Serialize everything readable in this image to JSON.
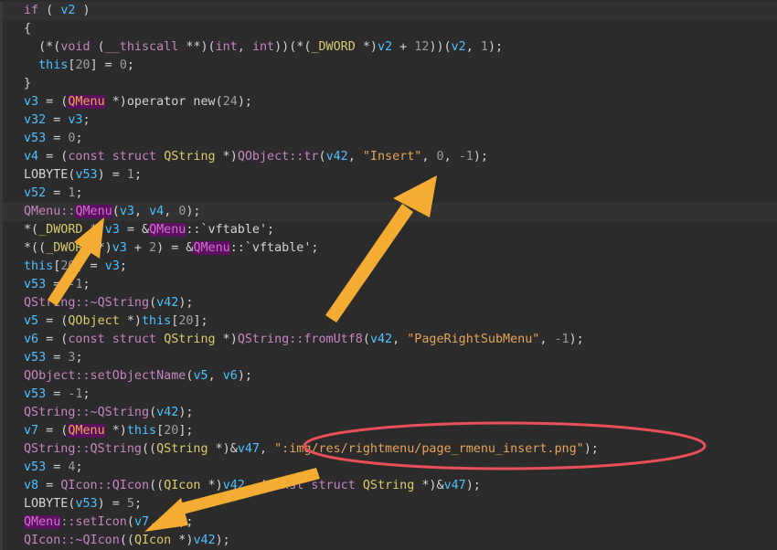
{
  "lines": [
    {
      "tokens": [
        [
          "kw",
          "if"
        ],
        [
          "plain",
          " ( "
        ],
        [
          "var",
          "v2"
        ],
        [
          "plain",
          " )"
        ]
      ]
    },
    {
      "tokens": [
        [
          "plain",
          "{"
        ]
      ]
    },
    {
      "tokens": [
        [
          "plain",
          "  (*("
        ],
        [
          "kw",
          "void"
        ],
        [
          "plain",
          " ("
        ],
        [
          "kw",
          "__thiscall"
        ],
        [
          "plain",
          " **)("
        ],
        [
          "kw",
          "int"
        ],
        [
          "plain",
          ", "
        ],
        [
          "kw",
          "int"
        ],
        [
          "plain",
          "))(*("
        ],
        [
          "type",
          "_DWORD"
        ],
        [
          "plain",
          " *)"
        ],
        [
          "var",
          "v2"
        ],
        [
          "plain",
          " + "
        ],
        [
          "num",
          "12"
        ],
        [
          "plain",
          "))("
        ],
        [
          "var",
          "v2"
        ],
        [
          "plain",
          ", "
        ],
        [
          "num",
          "1"
        ],
        [
          "plain",
          ");"
        ]
      ]
    },
    {
      "tokens": [
        [
          "plain",
          "  "
        ],
        [
          "var",
          "this"
        ],
        [
          "plain",
          "["
        ],
        [
          "num",
          "20"
        ],
        [
          "plain",
          "] = "
        ],
        [
          "num",
          "0"
        ],
        [
          "plain",
          ";"
        ]
      ]
    },
    {
      "tokens": [
        [
          "plain",
          "}"
        ]
      ]
    },
    {
      "tokens": [
        [
          "var",
          "v3"
        ],
        [
          "plain",
          " = ("
        ],
        [
          "cls",
          "QMenu"
        ],
        [
          "plain",
          " *)"
        ],
        [
          "plain",
          "operator new"
        ],
        [
          "plain",
          "("
        ],
        [
          "num",
          "24"
        ],
        [
          "plain",
          ");"
        ]
      ]
    },
    {
      "tokens": [
        [
          "var",
          "v32"
        ],
        [
          "plain",
          " = "
        ],
        [
          "var",
          "v3"
        ],
        [
          "plain",
          ";"
        ]
      ]
    },
    {
      "tokens": [
        [
          "var",
          "v53"
        ],
        [
          "plain",
          " = "
        ],
        [
          "num",
          "0"
        ],
        [
          "plain",
          ";"
        ]
      ]
    },
    {
      "tokens": [
        [
          "var",
          "v4"
        ],
        [
          "plain",
          " = ("
        ],
        [
          "kw",
          "const struct"
        ],
        [
          "plain",
          " "
        ],
        [
          "type",
          "QString"
        ],
        [
          "plain",
          " *)"
        ],
        [
          "fn",
          "QObject::tr"
        ],
        [
          "plain",
          "("
        ],
        [
          "var",
          "v42"
        ],
        [
          "plain",
          ", "
        ],
        [
          "str",
          "\"Insert\""
        ],
        [
          "plain",
          ", "
        ],
        [
          "num",
          "0"
        ],
        [
          "plain",
          ", "
        ],
        [
          "num",
          "-1"
        ],
        [
          "plain",
          ");"
        ]
      ]
    },
    {
      "tokens": [
        [
          "plain",
          "LOBYTE("
        ],
        [
          "var",
          "v53"
        ],
        [
          "plain",
          ") = "
        ],
        [
          "num",
          "1"
        ],
        [
          "plain",
          ";"
        ]
      ]
    },
    {
      "tokens": [
        [
          "var",
          "v52"
        ],
        [
          "plain",
          " = "
        ],
        [
          "num",
          "1"
        ],
        [
          "plain",
          ";"
        ]
      ]
    },
    {
      "tokens": [
        [
          "fn",
          "QMenu::"
        ],
        [
          "cls-p",
          "QMenu"
        ],
        [
          "plain",
          "("
        ],
        [
          "var",
          "v3"
        ],
        [
          "plain",
          ", "
        ],
        [
          "var",
          "v4"
        ],
        [
          "plain",
          ", "
        ],
        [
          "num",
          "0"
        ],
        [
          "plain",
          ");"
        ]
      ],
      "hl": true
    },
    {
      "tokens": [
        [
          "plain",
          "*("
        ],
        [
          "type",
          "_DWORD"
        ],
        [
          "plain",
          " *)"
        ],
        [
          "var",
          "v3"
        ],
        [
          "plain",
          " = &"
        ],
        [
          "cls-p",
          "QMenu"
        ],
        [
          "plain",
          "::`vftable';"
        ]
      ]
    },
    {
      "tokens": [
        [
          "plain",
          "*(("
        ],
        [
          "type",
          "_DWORD"
        ],
        [
          "plain",
          " *)"
        ],
        [
          "var",
          "v3"
        ],
        [
          "plain",
          " + "
        ],
        [
          "num",
          "2"
        ],
        [
          "plain",
          ") = &"
        ],
        [
          "cls-p",
          "QMenu"
        ],
        [
          "plain",
          "::`vftable';"
        ]
      ]
    },
    {
      "tokens": [
        [
          "var",
          "this"
        ],
        [
          "plain",
          "["
        ],
        [
          "num",
          "20"
        ],
        [
          "plain",
          "] = "
        ],
        [
          "var",
          "v3"
        ],
        [
          "plain",
          ";"
        ]
      ]
    },
    {
      "tokens": [
        [
          "var",
          "v53"
        ],
        [
          "plain",
          " = "
        ],
        [
          "num",
          "-1"
        ],
        [
          "plain",
          ";"
        ]
      ]
    },
    {
      "tokens": [
        [
          "fn",
          "QString::~QString"
        ],
        [
          "plain",
          "("
        ],
        [
          "var",
          "v42"
        ],
        [
          "plain",
          ");"
        ]
      ]
    },
    {
      "tokens": [
        [
          "var",
          "v5"
        ],
        [
          "plain",
          " = ("
        ],
        [
          "type",
          "QObject"
        ],
        [
          "plain",
          " *)"
        ],
        [
          "var",
          "this"
        ],
        [
          "plain",
          "["
        ],
        [
          "num",
          "20"
        ],
        [
          "plain",
          "];"
        ]
      ]
    },
    {
      "tokens": [
        [
          "var",
          "v6"
        ],
        [
          "plain",
          " = ("
        ],
        [
          "kw",
          "const struct"
        ],
        [
          "plain",
          " "
        ],
        [
          "type",
          "QString"
        ],
        [
          "plain",
          " *)"
        ],
        [
          "fn",
          "QString::fromUtf8"
        ],
        [
          "plain",
          "("
        ],
        [
          "var",
          "v42"
        ],
        [
          "plain",
          ", "
        ],
        [
          "str",
          "\"PageRightSubMenu\""
        ],
        [
          "plain",
          ", "
        ],
        [
          "num",
          "-1"
        ],
        [
          "plain",
          ");"
        ]
      ]
    },
    {
      "tokens": [
        [
          "var",
          "v53"
        ],
        [
          "plain",
          " = "
        ],
        [
          "num",
          "3"
        ],
        [
          "plain",
          ";"
        ]
      ]
    },
    {
      "tokens": [
        [
          "fn",
          "QObject::setObjectName"
        ],
        [
          "plain",
          "("
        ],
        [
          "var",
          "v5"
        ],
        [
          "plain",
          ", "
        ],
        [
          "var",
          "v6"
        ],
        [
          "plain",
          ");"
        ]
      ]
    },
    {
      "tokens": [
        [
          "var",
          "v53"
        ],
        [
          "plain",
          " = "
        ],
        [
          "num",
          "-1"
        ],
        [
          "plain",
          ";"
        ]
      ]
    },
    {
      "tokens": [
        [
          "fn",
          "QString::~QString"
        ],
        [
          "plain",
          "("
        ],
        [
          "var",
          "v42"
        ],
        [
          "plain",
          ");"
        ]
      ]
    },
    {
      "tokens": [
        [
          "var",
          "v7"
        ],
        [
          "plain",
          " = ("
        ],
        [
          "cls",
          "QMenu"
        ],
        [
          "plain",
          " *)"
        ],
        [
          "var",
          "this"
        ],
        [
          "plain",
          "["
        ],
        [
          "num",
          "20"
        ],
        [
          "plain",
          "];"
        ]
      ]
    },
    {
      "tokens": [
        [
          "fn",
          "QString::QString"
        ],
        [
          "plain",
          "(("
        ],
        [
          "type",
          "QString"
        ],
        [
          "plain",
          " *)&"
        ],
        [
          "var",
          "v47"
        ],
        [
          "plain",
          ", "
        ],
        [
          "str",
          "\":img/res/rightmenu/page_rmenu_insert.png\""
        ],
        [
          "plain",
          ");"
        ]
      ]
    },
    {
      "tokens": [
        [
          "var",
          "v53"
        ],
        [
          "plain",
          " = "
        ],
        [
          "num",
          "4"
        ],
        [
          "plain",
          ";"
        ]
      ]
    },
    {
      "tokens": [
        [
          "var",
          "v8"
        ],
        [
          "plain",
          " = "
        ],
        [
          "fn",
          "QIcon::QIcon"
        ],
        [
          "plain",
          "(("
        ],
        [
          "type",
          "QIcon"
        ],
        [
          "plain",
          " *)"
        ],
        [
          "var",
          "v42"
        ],
        [
          "plain",
          ", ("
        ],
        [
          "kw",
          "const struct"
        ],
        [
          "plain",
          " "
        ],
        [
          "type",
          "QString"
        ],
        [
          "plain",
          " *)&"
        ],
        [
          "var",
          "v47"
        ],
        [
          "plain",
          ");"
        ]
      ]
    },
    {
      "tokens": [
        [
          "plain",
          "LOBYTE("
        ],
        [
          "var",
          "v53"
        ],
        [
          "plain",
          ") = "
        ],
        [
          "num",
          "5"
        ],
        [
          "plain",
          ";"
        ]
      ]
    },
    {
      "tokens": [
        [
          "cls-p",
          "QMenu"
        ],
        [
          "fn",
          "::setIcon"
        ],
        [
          "plain",
          "("
        ],
        [
          "var",
          "v7"
        ],
        [
          "plain",
          ", "
        ],
        [
          "var",
          "v8"
        ],
        [
          "plain",
          ");"
        ]
      ]
    },
    {
      "tokens": [
        [
          "fn",
          "QIcon::~QIcon"
        ],
        [
          "plain",
          "(("
        ],
        [
          "type",
          "QIcon"
        ],
        [
          "plain",
          " *)"
        ],
        [
          "var",
          "v42"
        ],
        [
          "plain",
          ");"
        ]
      ]
    }
  ],
  "colors": {
    "background": "#2b2b2b",
    "arrow": "#f5ac33",
    "ellipse": "#e8505a"
  }
}
